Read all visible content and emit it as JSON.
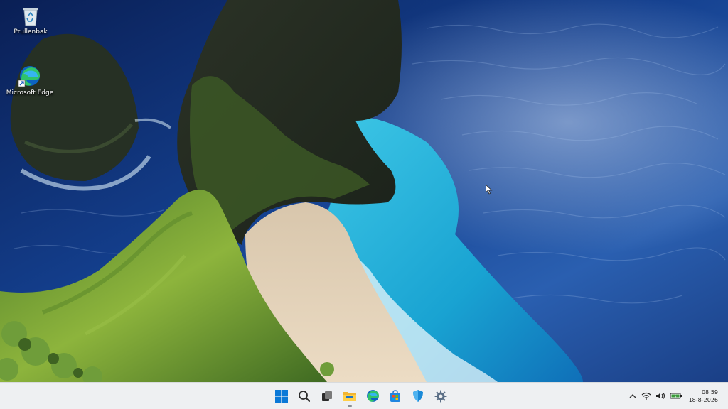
{
  "desktop": {
    "icons": [
      {
        "label": "Prullenbak",
        "icon": "recycle-bin-icon"
      },
      {
        "label": "Microsoft Edge",
        "icon": "edge-icon"
      }
    ]
  },
  "taskbar": {
    "apps": [
      {
        "name": "Start",
        "icon": "windows-start-icon"
      },
      {
        "name": "Search",
        "icon": "search-icon"
      },
      {
        "name": "Task View",
        "icon": "task-view-icon"
      },
      {
        "name": "File Explorer",
        "icon": "folder-icon"
      },
      {
        "name": "Microsoft Edge",
        "icon": "edge-icon"
      },
      {
        "name": "Microsoft Store",
        "icon": "store-icon"
      },
      {
        "name": "Windows Security",
        "icon": "shield-icon"
      },
      {
        "name": "Settings",
        "icon": "gear-icon"
      }
    ],
    "tray": {
      "time": "08:59",
      "date": "18-8-2026",
      "icons": [
        "chevron-up-icon",
        "wifi-icon",
        "volume-icon",
        "battery-icon"
      ]
    }
  },
  "colors": {
    "taskbar_bg": "#eef0f2",
    "accent": "#0078d4",
    "ocean_deep": "#0d2a6e",
    "lagoon": "#2fb3d9",
    "sand": "#e6d3b8",
    "cliff_green": "#7aa83a"
  }
}
